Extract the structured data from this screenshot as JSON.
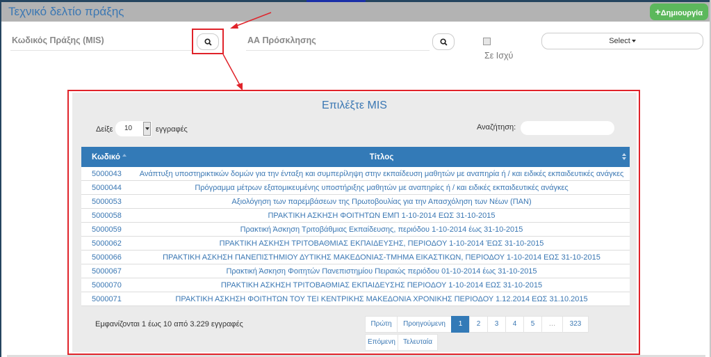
{
  "page": {
    "title": "Τεχνικό δελτίο πράξης",
    "create_button": "Δημιουργία",
    "create_icon": "plus-icon"
  },
  "filters": {
    "mis_label": "Κωδικός Πράξης (MIS)",
    "call_label": "ΑΑ Πρόσκλησης",
    "search_icon": "search-icon",
    "in_force_label": "Σε Ισχύ",
    "in_force_checked": false,
    "select_label": "Select"
  },
  "colors": {
    "accent": "#337ab7",
    "title_blue": "#3a77b3",
    "create_green": "#5cb85c",
    "annotation_red": "#e0232a",
    "header_gray": "#b3b3b3"
  },
  "modal": {
    "title": "Επιλέξτε MIS",
    "show_label": "Δείξε",
    "page_length": "10",
    "entries_label": "εγγραφές",
    "search_label": "Αναζήτηση:",
    "search_value": "",
    "columns": [
      "Κωδικό",
      "Τίτλος"
    ],
    "rows": [
      {
        "code": "5000043",
        "title": "Ανάπτυξη υποστηρικτικών δομών για την ένταξη και συμπερίληψη στην εκπαίδευση μαθητών με αναπηρία ή / και ειδικές εκπαιδευτικές ανάγκες"
      },
      {
        "code": "5000044",
        "title": "Πρόγραμμα μέτρων εξατομικευμένης υποστήριξης μαθητών με αναπηρίες ή / και ειδικές εκπαιδευτικές ανάγκες"
      },
      {
        "code": "5000053",
        "title": "Αξιολόγηση των παρεμβάσεων της Πρωτοβουλίας για την Απασχόληση των Νέων (ΠΑΝ)"
      },
      {
        "code": "5000058",
        "title": "ΠΡΑΚΤΙΚΗ ΑΣΚΗΣΗ ΦΟΙΤΗΤΩΝ ΕΜΠ 1-10-2014 ΕΩΣ 31-10-2015"
      },
      {
        "code": "5000059",
        "title": "Πρακτική Άσκηση Τριτοβάθμιας Εκπαίδευσης, περιόδου 1-10-2014 έως 31-10-2015"
      },
      {
        "code": "5000062",
        "title": "ΠΡΑΚΤΙΚΗ ΑΣΚΗΣΗ ΤΡΙΤΟΒΑΘΜΙΑΣ ΕΚΠΑΙΔΕΥΣΗΣ, ΠΕΡΙΟΔΟΥ 1-10-2014 ΈΩΣ 31-10-2015"
      },
      {
        "code": "5000066",
        "title": "ΠΡΑΚΤΙΚΗ ΑΣΚΗΣΗ ΠΑΝΕΠΙΣΤΗΜΙΟΥ ΔΥΤΙΚΗΣ ΜΑΚΕΔΟΝΙΑΣ-ΤΜΗΜΑ ΕΙΚΑΣΤΙΚΩΝ, ΠΕΡΙΟΔΟΥ 1-10-2014 ΕΩΣ 31-10-2015"
      },
      {
        "code": "5000067",
        "title": "Πρακτική Άσκηση Φοιτητών Πανεπιστημίου Πειραιώς περιόδου 01-10-2014 έως 31-10-2015"
      },
      {
        "code": "5000070",
        "title": "ΠΡΑΚΤΙΚΗ ΑΣΚΗΣΗ ΤΡΙΤΟΒΑΘΜΙΑΣ ΕΚΠΑΙΔΕΥΣΗΣ ΠΕΡΙΟΔΟΥ 1-10-2014 ΕΩΣ 31-10-2015"
      },
      {
        "code": "5000071",
        "title": "ΠΡΑΚΤΙΚΗ ΑΣΚΗΣΗ ΦΟΙΤΗΤΩΝ ΤΟΥ ΤΕΙ ΚΕΝΤΡΙΚΗΣ ΜΑΚΕΔΟΝΙΑ ΧΡΟΝΙΚΗΣ ΠΕΡΙΟΔΟΥ 1.12.2014 ΕΩΣ 31.10.2015"
      }
    ],
    "info": "Εμφανίζονται 1 έως 10 από 3.229 εγγραφές",
    "pagination": {
      "first": "Πρώτη",
      "previous": "Προηγούμενη",
      "pages": [
        "1",
        "2",
        "3",
        "4",
        "5"
      ],
      "ellipsis": "…",
      "last_page": "323",
      "current": "1",
      "next": "Επόμενη",
      "last": "Τελευταία"
    }
  }
}
